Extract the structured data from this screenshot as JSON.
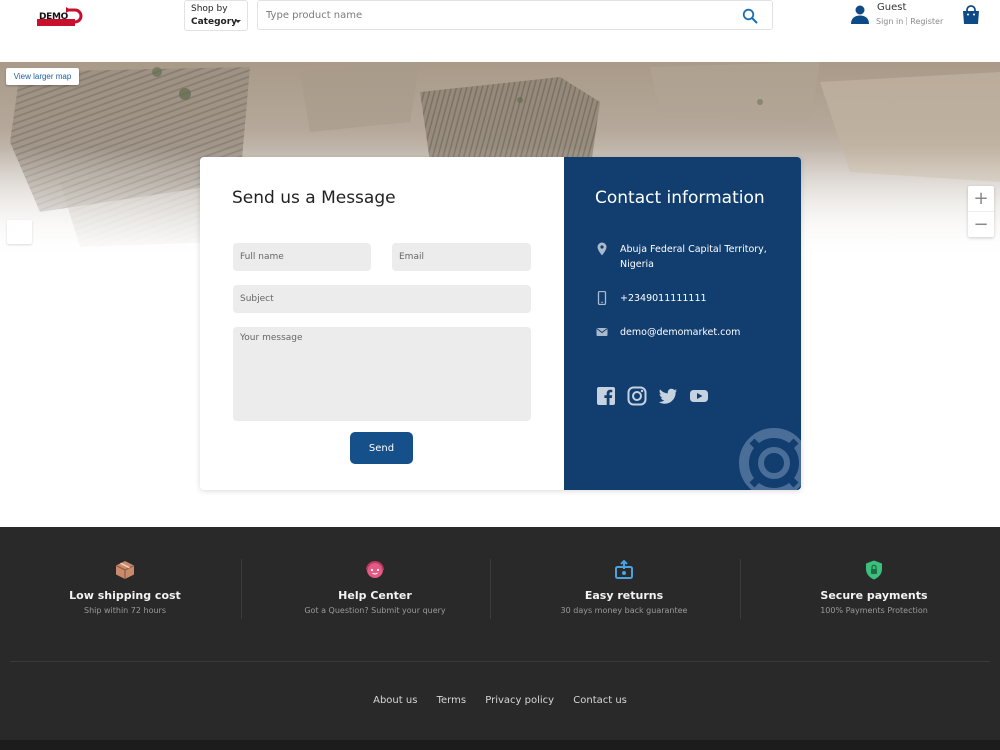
{
  "header": {
    "logo_text": "DEMO",
    "shop_by": "Shop by",
    "category": "Category",
    "search_placeholder": "Type product name",
    "user_name": "Guest",
    "sign_in": "Sign in",
    "register": "Register",
    "icons": [
      "search-icon",
      "user-icon",
      "shopping-bag-icon"
    ]
  },
  "map": {
    "view_larger": "View larger map",
    "zoom_in": "+",
    "zoom_out": "−"
  },
  "form": {
    "title": "Send us a Message",
    "full_name_placeholder": "Full name",
    "email_placeholder": "Email",
    "subject_placeholder": "Subject",
    "message_placeholder": "Your message",
    "send_label": "Send"
  },
  "contact": {
    "title": "Contact information",
    "address": "Abuja Federal Capital Territory, Nigeria",
    "phone": "+2349011111111",
    "email": "demo@demomarket.com",
    "socials": [
      "facebook-icon",
      "instagram-icon",
      "twitter-icon",
      "youtube-icon"
    ],
    "panel_color": "#113e6f"
  },
  "features": [
    {
      "title": "Low shipping cost",
      "subtitle": "Ship within 72 hours",
      "icon": "box-icon",
      "color": "#c98a6b"
    },
    {
      "title": "Help Center",
      "subtitle": "Got a Question? Submit your query",
      "icon": "support-icon",
      "color": "#e35a86"
    },
    {
      "title": "Easy returns",
      "subtitle": "30 days money back guarantee",
      "icon": "return-icon",
      "color": "#4aa3e0"
    },
    {
      "title": "Secure payments",
      "subtitle": "100% Payments Protection",
      "icon": "shield-lock-icon",
      "color": "#3bbf7a"
    }
  ],
  "footer_links": [
    "About us",
    "Terms",
    "Privacy policy",
    "Contact us"
  ]
}
